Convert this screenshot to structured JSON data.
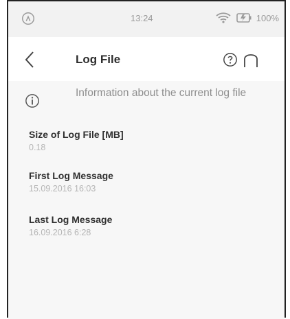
{
  "status_bar": {
    "time": "13:24",
    "battery": "100%"
  },
  "header": {
    "title": "Log File"
  },
  "info": {
    "text": "Information about the current log file"
  },
  "fields": [
    {
      "label": "Size of Log File [MB]",
      "value": "0.18"
    },
    {
      "label": "First Log Message",
      "value": "15.09.2016 16:03"
    },
    {
      "label": "Last Log Message",
      "value": "16.09.2016 6:28"
    }
  ],
  "icons": {
    "status_left": "signal-power-icon",
    "wifi": "wifi-icon",
    "battery": "battery-charging-icon",
    "back": "chevron-left-icon",
    "help": "help-icon",
    "home": "home-icon",
    "info": "info-icon"
  }
}
